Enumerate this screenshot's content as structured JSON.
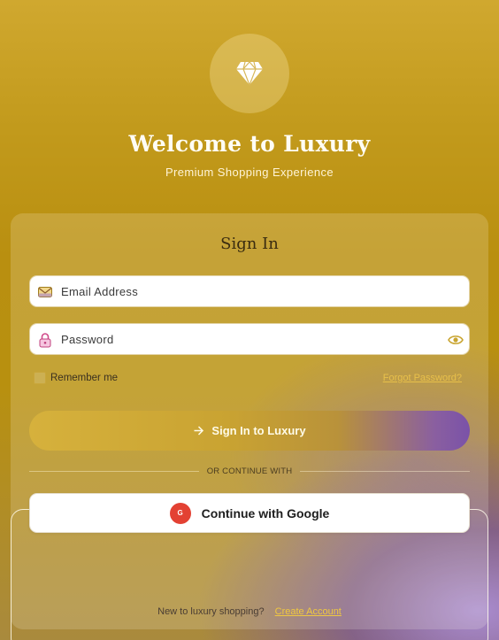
{
  "hero": {
    "logo_icon": "diamond-icon",
    "title": "Welcome to Luxury",
    "subtitle": "Premium Shopping Experience"
  },
  "card": {
    "title": "Sign In",
    "email": {
      "placeholder": "Email Address",
      "value": "",
      "icon": "envelope-icon"
    },
    "password": {
      "placeholder": "Password",
      "value": "",
      "icon": "lock-icon",
      "toggle_icon": "eye-icon"
    },
    "remember_label": "Remember me",
    "remember_checked": false,
    "forgot_label": "Forgot Password?",
    "signin_label": "Sign In to Luxury",
    "signin_icon": "arrow-right-icon",
    "divider_text": "OR CONTINUE WITH",
    "google_badge": "G",
    "google_label": "Continue with Google",
    "footer_text": "New to luxury shopping?",
    "create_label": "Create Account"
  },
  "colors": {
    "gold": "#c29a1c",
    "accent_link": "#f0c840",
    "purple": "#7a52a8",
    "google_red": "#e34133"
  }
}
